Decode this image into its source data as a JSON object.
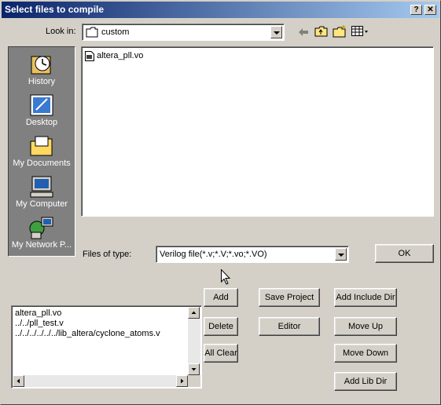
{
  "window": {
    "title": "Select files to compile",
    "help_button": "?",
    "close_button": "✕"
  },
  "lookin": {
    "label": "Look in:",
    "value": "custom"
  },
  "places": [
    {
      "label": "History"
    },
    {
      "label": "Desktop"
    },
    {
      "label": "My Documents"
    },
    {
      "label": "My Computer"
    },
    {
      "label": "My Network P..."
    }
  ],
  "file_list": [
    {
      "name": "altera_pll.vo"
    }
  ],
  "filetype": {
    "label": "Files of type:",
    "value": "Verilog file(*.v;*.V;*.vo;*.VO)"
  },
  "ok_label": "OK",
  "selected_files": [
    "altera_pll.vo",
    "../../pll_test.v",
    "../../../../../../lib_altera/cyclone_atoms.v"
  ],
  "buttons": {
    "add": "Add",
    "delete": "Delete",
    "all_clear": "All Clear",
    "save_project": "Save Project",
    "editor": "Editor",
    "add_include_dir": "Add Include Dir",
    "move_up": "Move Up",
    "move_down": "Move Down",
    "add_lib_dir": "Add Lib Dir"
  }
}
